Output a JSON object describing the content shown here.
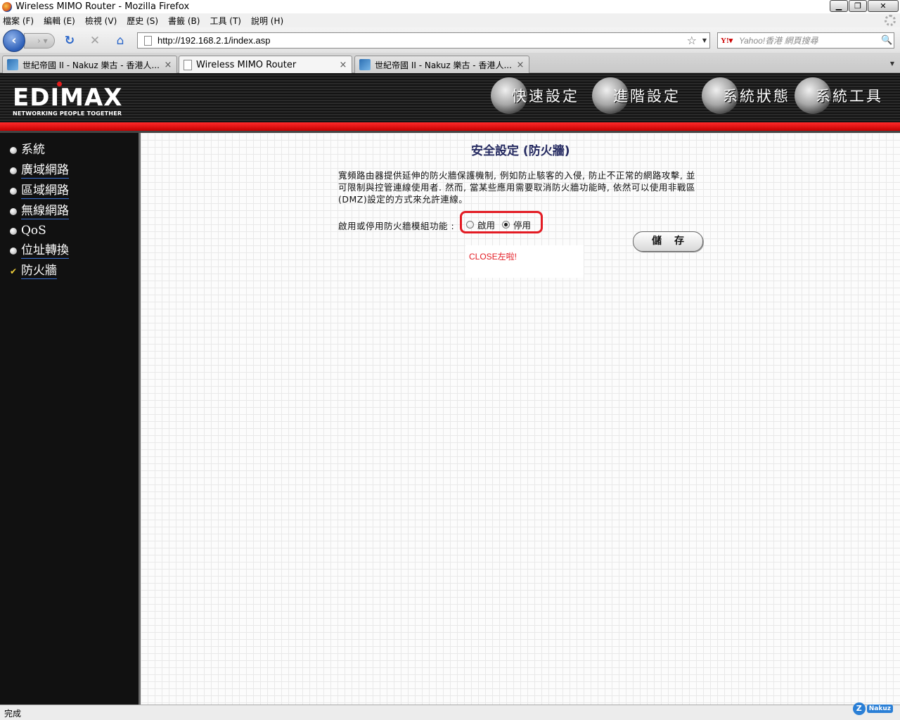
{
  "window": {
    "title": "Wireless MIMO Router - Mozilla Firefox",
    "min_label": "▁",
    "max_label": "❐",
    "close_label": "✕"
  },
  "menubar": {
    "items": [
      "檔案 (F)",
      "編輯 (E)",
      "檢視 (V)",
      "歷史 (S)",
      "書籤 (B)",
      "工具 (T)",
      "說明 (H)"
    ]
  },
  "navbar": {
    "back_icon": "‹",
    "forward_icon": "› ▾",
    "reload_icon": "↻",
    "stop_icon": "✕",
    "home_icon": "⌂",
    "url": "http://192.168.2.1/index.asp",
    "bookmark_icon": "☆",
    "url_dropdown_icon": "▼",
    "search_engine": "Y!▾",
    "search_placeholder": "Yahoo!香港 網頁搜尋",
    "search_icon": "🔍"
  },
  "tabs": [
    {
      "label": "世紀帝國 II - Nakuz 樂古 - 香港人...",
      "active": false,
      "icon": "nakuz"
    },
    {
      "label": "Wireless MIMO Router",
      "active": true,
      "icon": "blank"
    },
    {
      "label": "世紀帝國 II - Nakuz 樂古 - 香港人...",
      "active": false,
      "icon": "nakuz"
    }
  ],
  "tab_close_icon": "×",
  "all_tabs_icon": "▼",
  "router": {
    "logo": "EDIMAX",
    "tagline": "NETWORKING PEOPLE TOGETHER",
    "top_nav": [
      "快速設定",
      "進階設定",
      "系統狀態",
      "系統工具"
    ],
    "sidebar": [
      {
        "label": "系統",
        "marker": "bullet"
      },
      {
        "label": "廣域網路",
        "marker": "bullet"
      },
      {
        "label": "區域網路",
        "marker": "bullet"
      },
      {
        "label": "無線網路",
        "marker": "bullet"
      },
      {
        "label": "QoS",
        "marker": "bullet"
      },
      {
        "label": "位址轉換",
        "marker": "bullet"
      },
      {
        "label": "防火牆",
        "marker": "check"
      }
    ],
    "page_title": "安全設定 (防火牆)",
    "description": "寬頻路由器提供延伸的防火牆保護機制, 例如防止駭客的入侵, 防止不正常的網路攻擊, 並可限制與控管連線使用者. 然而, 當某些應用需要取消防火牆功能時, 依然可以使用非戰區(DMZ)設定的方式來允許連線。",
    "toggle_label": "啟用或停用防火牆模組功能 :",
    "enable_label": "啟用",
    "disable_label": "停用",
    "selected": "disable",
    "save_label": "儲存",
    "note": "CLOSE左啦!"
  },
  "statusbar": {
    "text": "完成",
    "badge": "Nakuz"
  },
  "colors": {
    "highlight_red": "#e31b23",
    "title_navy": "#252a61",
    "header_red": "#e00000"
  }
}
